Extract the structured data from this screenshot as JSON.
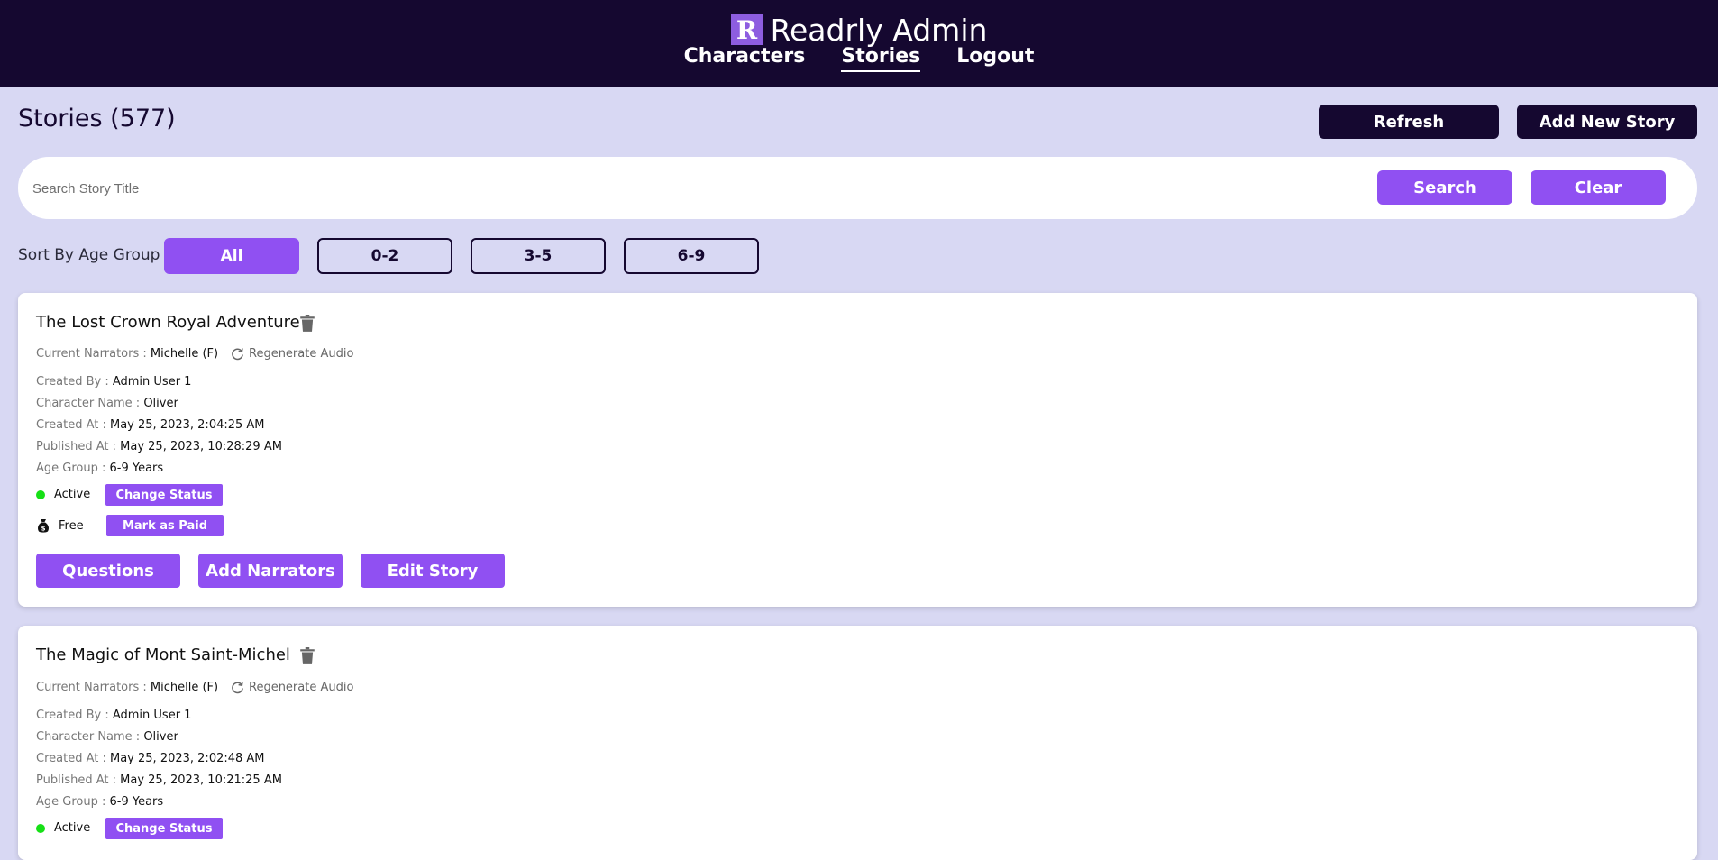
{
  "header": {
    "logo_letter": "R",
    "title": "Readrly Admin",
    "nav": [
      {
        "label": "Characters",
        "active": false
      },
      {
        "label": "Stories",
        "active": true
      },
      {
        "label": "Logout",
        "active": false
      }
    ]
  },
  "page": {
    "title": "Stories (577)",
    "refresh_label": "Refresh",
    "add_label": "Add New Story"
  },
  "search": {
    "placeholder": "Search Story Title",
    "value": "",
    "search_label": "Search",
    "clear_label": "Clear"
  },
  "sort": {
    "label": "Sort By Age Group",
    "options": [
      "All",
      "0-2",
      "3-5",
      "6-9"
    ],
    "selected": "All"
  },
  "labels": {
    "narrators": "Current Narrators : ",
    "regenerate": "Regenerate Audio",
    "created_by": "Created By : ",
    "character": "Character Name : ",
    "created_at": "Created At : ",
    "published_at": "Published At : ",
    "age_group": "Age Group : ",
    "change_status": "Change Status",
    "mark_paid": "Mark as Paid",
    "questions": "Questions",
    "add_narrators": "Add Narrators",
    "edit_story": "Edit Story"
  },
  "stories": [
    {
      "title": "The Lost Crown Royal Adventure",
      "narrators": "Michelle (F)",
      "created_by": "Admin User 1",
      "character": "Oliver",
      "created_at": "May 25, 2023, 2:04:25 AM",
      "published_at": "May 25, 2023, 10:28:29 AM",
      "age_group": "6-9 Years",
      "status": "Active",
      "price": "Free"
    },
    {
      "title": "The Magic of Mont Saint-Michel",
      "narrators": "Michelle (F)",
      "created_by": "Admin User 1",
      "character": "Oliver",
      "created_at": "May 25, 2023, 2:02:48 AM",
      "published_at": "May 25, 2023, 10:21:25 AM",
      "age_group": "6-9 Years",
      "status": "Active"
    }
  ],
  "colors": {
    "header_bg": "#150830",
    "accent": "#9050f2",
    "page_bg": "#d8d8f3",
    "status_active": "#16e016"
  }
}
